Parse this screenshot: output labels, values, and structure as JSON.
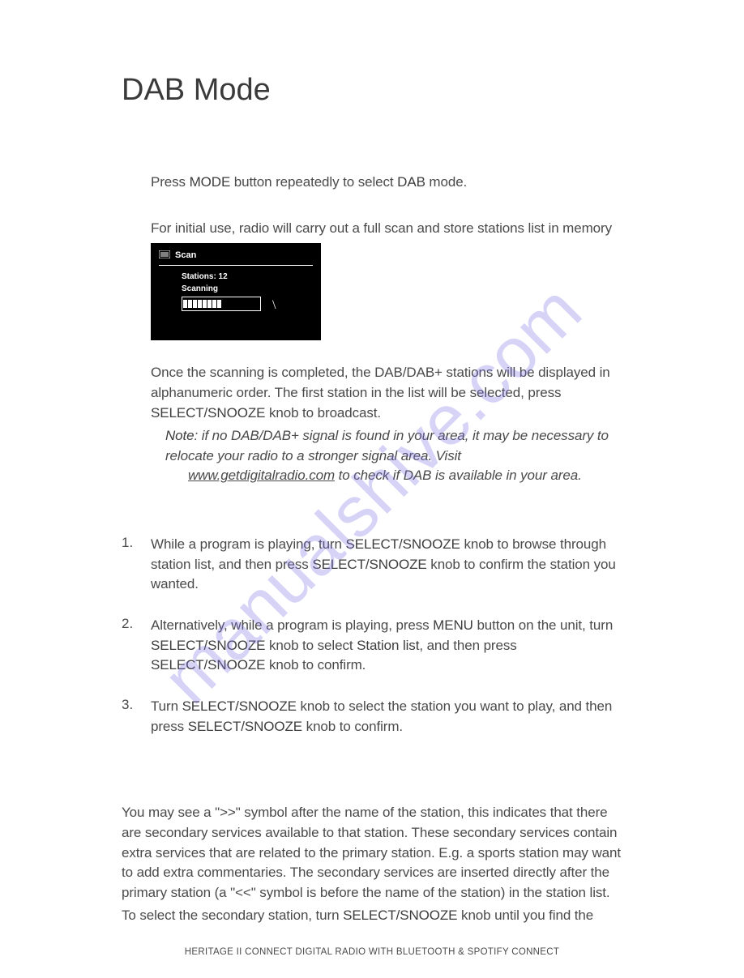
{
  "title": "DAB Mode",
  "watermark": "manualshive.com",
  "intro": {
    "press_before": "Press ",
    "press_bold": "MODE",
    "press_mid": " button repeatedly to select ",
    "press_bold2": "DAB",
    "press_after": " mode.",
    "initial": "For initial use, radio will carry out a full scan and store stations list in memory"
  },
  "scan": {
    "label": "Scan",
    "stations": "Stations: 12",
    "scanning": "Scanning",
    "cursor": "\\"
  },
  "after_scan": {
    "line1": "Once the scanning is completed, the DAB/DAB+ stations will be displayed in alphanumeric order. The first station in the list will be selected, press ",
    "bold1": "SELECT/SNOOZE",
    "line1_after": " knob to broadcast."
  },
  "note": {
    "label": "Note",
    "text1": ": if no DAB/DAB+ signal is found in your area, it may be necessary to relocate your radio to a stronger signal area. Visit ",
    "link": "www.getdigitalradio.com",
    "text2": " to check if DAB is available in your area."
  },
  "steps": {
    "s1_num": "1.",
    "s1_a": "While a program is playing, turn ",
    "s1_b1": "SELECT/SNOOZE",
    "s1_c": " knob to browse through station list, and then press ",
    "s1_b2": "SELECT/SNOOZE",
    "s1_d": " knob to confirm the station you wanted.",
    "s2_num": "2.",
    "s2_a": "Alternatively, while a program is playing, press ",
    "s2_b1": "MENU",
    "s2_c": " button on the unit, turn ",
    "s2_b2": "SELECT/SNOOZE",
    "s2_d": " knob to select ",
    "s2_b3": "Station list",
    "s2_e": ", and then press ",
    "s2_b4": "SELECT/SNOOZE",
    "s2_f": " knob to confirm.",
    "s3_num": "3.",
    "s3_a": "Turn ",
    "s3_b1": "SELECT/SNOOZE",
    "s3_c": " knob to select the station you want to play, and then press ",
    "s3_b2": "SELECT/SNOOZE",
    "s3_d": " knob to confirm."
  },
  "secondary": {
    "p1": "You may see a \">>\" symbol after the name of the station, this indicates that there are secondary services available to that station. These secondary services contain extra services that are related to the primary station. E.g. a sports station may want to add extra commentaries. The secondary services are inserted directly after the primary station (a \"<<\" symbol is before the name of the station) in the station list.",
    "p2_a": "To select the secondary station, turn ",
    "p2_b": "SELECT/SNOOZE",
    "p2_c": " knob until you find the"
  },
  "footer": "HERITAGE II CONNECT DIGITAL RADIO WITH BLUETOOTH & SPOTIFY CONNECT"
}
